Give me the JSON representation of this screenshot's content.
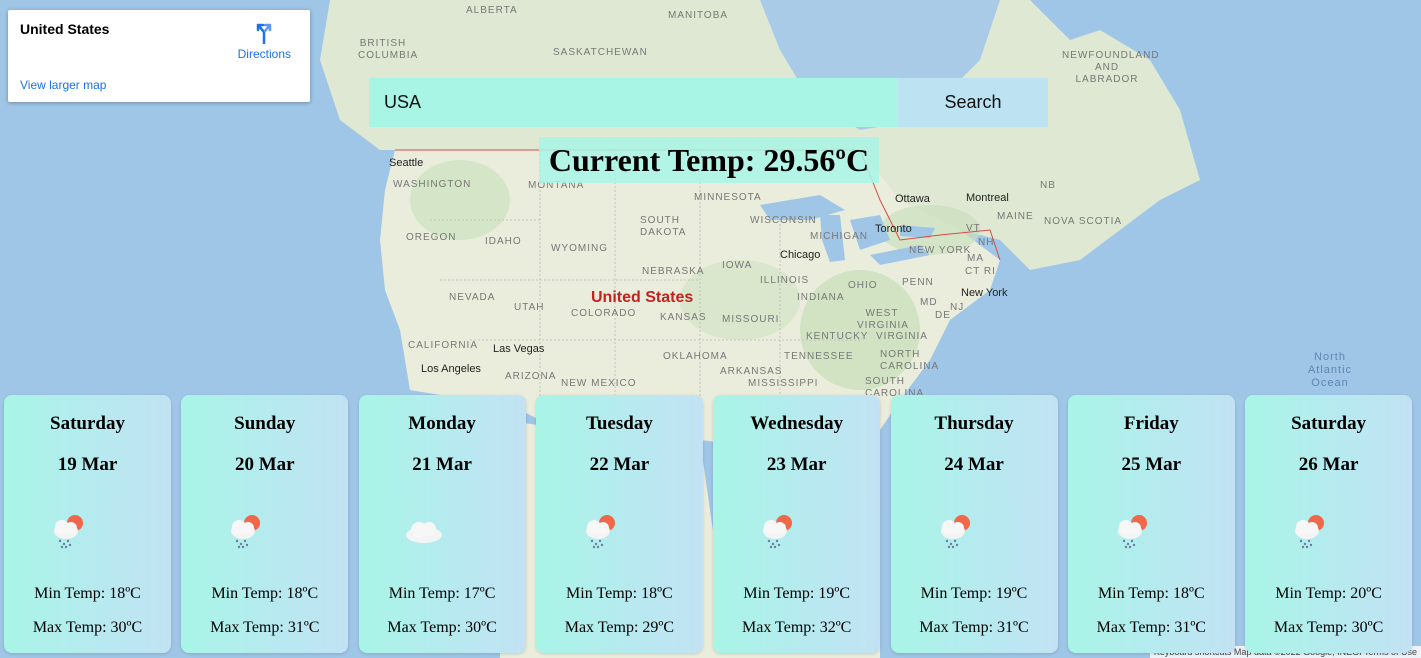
{
  "map": {
    "place_name": "United States",
    "directions_label": "Directions",
    "view_larger_label": "View larger map",
    "country_label": "United States",
    "ocean_label": "North Atlantic Ocean",
    "attribution": "Keyboard shortcuts   Map data ©2022 Google, INEGI   Terms of Use",
    "region_labels": {
      "alberta": "ALBERTA",
      "manitoba": "MANITOBA",
      "british_columbia": "BRITISH COLUMBIA",
      "saskatchewan": "SASKATCHEWAN",
      "newfoundland": "NEWFOUNDLAND AND LABRADOR",
      "washington": "WASHINGTON",
      "montana": "MONTANA",
      "minnesota": "MINNESOTA",
      "nb": "NB",
      "oregon": "OREGON",
      "idaho": "IDAHO",
      "south_dakota": "SOUTH DAKOTA",
      "wisconsin": "WISCONSIN",
      "michigan": "MICHIGAN",
      "maine": "MAINE",
      "nova_scotia": "NOVA SCOTIA",
      "wyoming": "WYOMING",
      "new_york_state": "NEW YORK",
      "vt": "VT",
      "nh": "NH",
      "nebraska": "NEBRASKA",
      "iowa": "IOWA",
      "ma": "MA",
      "ct_ri": "CT RI",
      "nevada": "NEVADA",
      "utah": "UTAH",
      "illinois": "ILLINOIS",
      "ohio": "OHIO",
      "penn": "PENN",
      "nj": "NJ",
      "colorado": "COLORADO",
      "kansas": "KANSAS",
      "missouri": "MISSOURI",
      "indiana": "INDIANA",
      "west_virginia": "WEST VIRGINIA",
      "md": "MD",
      "de": "DE",
      "virginia": "VIRGINIA",
      "kentucky": "KENTUCKY",
      "california": "CALIFORNIA",
      "oklahoma": "OKLAHOMA",
      "tennessee": "TENNESSEE",
      "north_carolina": "NORTH CAROLINA",
      "arizona": "ARIZONA",
      "new_mexico": "NEW MEXICO",
      "arkansas": "ARKANSAS",
      "south_carolina": "SOUTH CAROLINA",
      "mississippi": "MISSISSIPPI"
    },
    "cities": {
      "seattle": "Seattle",
      "ottawa": "Ottawa",
      "montreal": "Montreal",
      "toronto": "Toronto",
      "chicago": "Chicago",
      "new_york": "New York",
      "las_vegas": "Las Vegas",
      "los_angeles": "Los Angeles"
    }
  },
  "search": {
    "value": "USA",
    "button_label": "Search"
  },
  "current_temp": "Current Temp: 29.56ºC",
  "forecast": [
    {
      "day": "Saturday",
      "date": "19 Mar",
      "icon": "rain-sun-icon",
      "min": "Min Temp: 18ºC",
      "max": "Max Temp: 30ºC"
    },
    {
      "day": "Sunday",
      "date": "20 Mar",
      "icon": "rain-sun-icon",
      "min": "Min Temp: 18ºC",
      "max": "Max Temp: 31ºC"
    },
    {
      "day": "Monday",
      "date": "21 Mar",
      "icon": "cloud-icon",
      "min": "Min Temp: 17ºC",
      "max": "Max Temp: 30ºC"
    },
    {
      "day": "Tuesday",
      "date": "22 Mar",
      "icon": "rain-sun-icon",
      "min": "Min Temp: 18ºC",
      "max": "Max Temp: 29ºC"
    },
    {
      "day": "Wednesday",
      "date": "23 Mar",
      "icon": "rain-sun-icon",
      "min": "Min Temp: 19ºC",
      "max": "Max Temp: 32ºC"
    },
    {
      "day": "Thursday",
      "date": "24 Mar",
      "icon": "rain-sun-icon",
      "min": "Min Temp: 19ºC",
      "max": "Max Temp: 31ºC"
    },
    {
      "day": "Friday",
      "date": "25 Mar",
      "icon": "rain-sun-icon",
      "min": "Min Temp: 18ºC",
      "max": "Max Temp: 31ºC"
    },
    {
      "day": "Saturday",
      "date": "26 Mar",
      "icon": "rain-sun-icon",
      "min": "Min Temp: 20ºC",
      "max": "Max Temp: 30ºC"
    }
  ],
  "colors": {
    "search_bg": "#a8f5e6",
    "button_bg": "#bde3f3",
    "card_gradient_start": "#a8f5e6",
    "card_gradient_end": "#c2e2f3",
    "water": "#9fc6e7",
    "land": "#e8eedc"
  }
}
